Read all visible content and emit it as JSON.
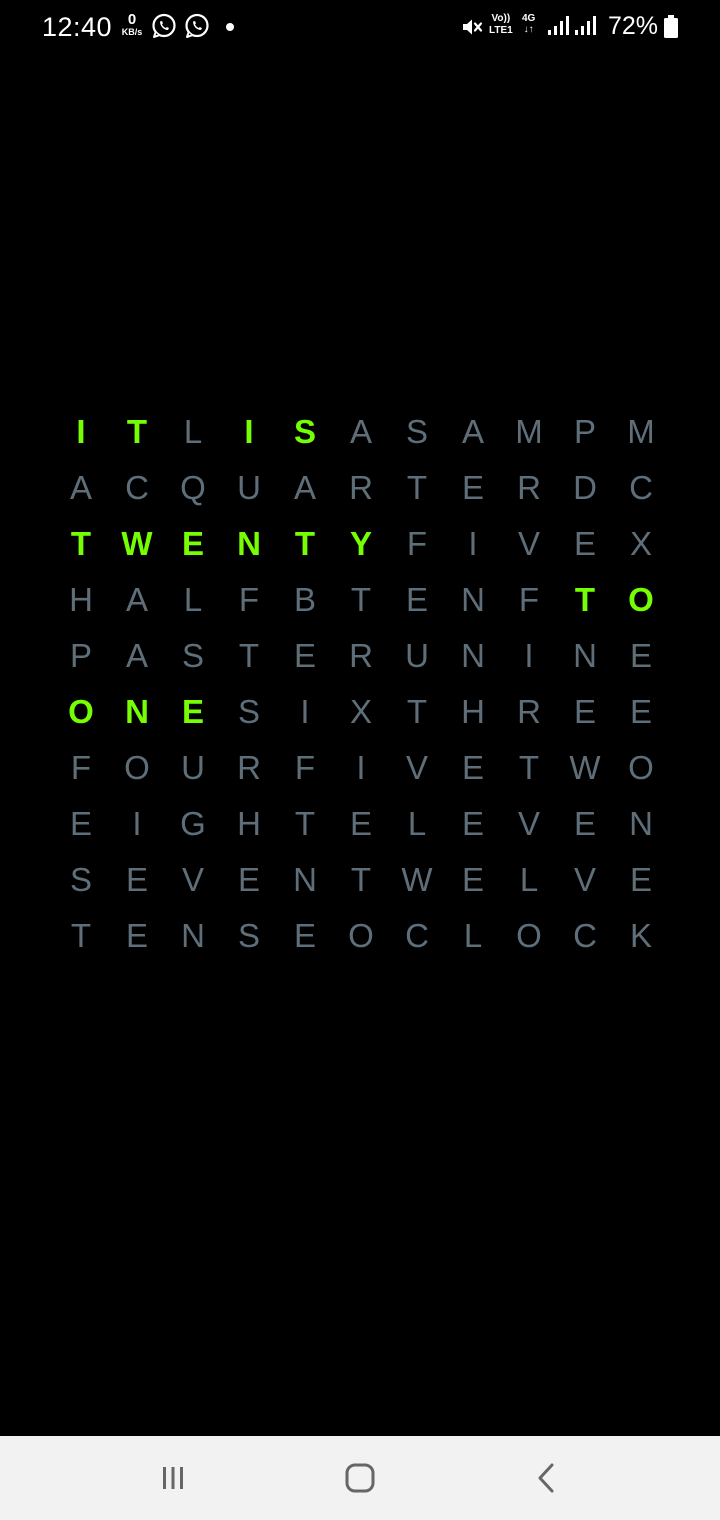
{
  "status_bar": {
    "time": "12:40",
    "net_speed_value": "0",
    "net_speed_unit": "KB/s",
    "volte_top": "Vo))",
    "volte_bottom": "LTE1",
    "network_type": "4G",
    "network_arrows": "↓↑",
    "battery_percent": "72%",
    "notification_icons": [
      "whatsapp-icon",
      "whatsapp-icon",
      "dot-icon"
    ],
    "system_icons": [
      "mute-icon",
      "volte-icon",
      "4g-icon",
      "signal-icon",
      "signal-icon",
      "battery-icon"
    ]
  },
  "word_clock": {
    "colors": {
      "on": "#76ff03",
      "off": "#5f6f7a",
      "background": "#000000"
    },
    "rows": [
      {
        "letters": [
          "I",
          "T",
          "L",
          "I",
          "S",
          "A",
          "S",
          "A",
          "M",
          "P",
          "M"
        ],
        "on": [
          1,
          1,
          0,
          1,
          1,
          0,
          0,
          0,
          0,
          0,
          0
        ]
      },
      {
        "letters": [
          "A",
          "C",
          "Q",
          "U",
          "A",
          "R",
          "T",
          "E",
          "R",
          "D",
          "C"
        ],
        "on": [
          0,
          0,
          0,
          0,
          0,
          0,
          0,
          0,
          0,
          0,
          0
        ]
      },
      {
        "letters": [
          "T",
          "W",
          "E",
          "N",
          "T",
          "Y",
          "F",
          "I",
          "V",
          "E",
          "X"
        ],
        "on": [
          1,
          1,
          1,
          1,
          1,
          1,
          0,
          0,
          0,
          0,
          0
        ]
      },
      {
        "letters": [
          "H",
          "A",
          "L",
          "F",
          "B",
          "T",
          "E",
          "N",
          "F",
          "T",
          "O"
        ],
        "on": [
          0,
          0,
          0,
          0,
          0,
          0,
          0,
          0,
          0,
          1,
          1
        ]
      },
      {
        "letters": [
          "P",
          "A",
          "S",
          "T",
          "E",
          "R",
          "U",
          "N",
          "I",
          "N",
          "E"
        ],
        "on": [
          0,
          0,
          0,
          0,
          0,
          0,
          0,
          0,
          0,
          0,
          0
        ]
      },
      {
        "letters": [
          "O",
          "N",
          "E",
          "S",
          "I",
          "X",
          "T",
          "H",
          "R",
          "E",
          "E"
        ],
        "on": [
          1,
          1,
          1,
          0,
          0,
          0,
          0,
          0,
          0,
          0,
          0
        ]
      },
      {
        "letters": [
          "F",
          "O",
          "U",
          "R",
          "F",
          "I",
          "V",
          "E",
          "T",
          "W",
          "O"
        ],
        "on": [
          0,
          0,
          0,
          0,
          0,
          0,
          0,
          0,
          0,
          0,
          0
        ]
      },
      {
        "letters": [
          "E",
          "I",
          "G",
          "H",
          "T",
          "E",
          "L",
          "E",
          "V",
          "E",
          "N"
        ],
        "on": [
          0,
          0,
          0,
          0,
          0,
          0,
          0,
          0,
          0,
          0,
          0
        ]
      },
      {
        "letters": [
          "S",
          "E",
          "V",
          "E",
          "N",
          "T",
          "W",
          "E",
          "L",
          "V",
          "E"
        ],
        "on": [
          0,
          0,
          0,
          0,
          0,
          0,
          0,
          0,
          0,
          0,
          0
        ]
      },
      {
        "letters": [
          "T",
          "E",
          "N",
          "S",
          "E",
          "O",
          "C",
          "L",
          "O",
          "C",
          "K"
        ],
        "on": [
          0,
          0,
          0,
          0,
          0,
          0,
          0,
          0,
          0,
          0,
          0
        ]
      }
    ]
  },
  "nav_bar": {
    "buttons": [
      "recents-icon",
      "home-icon",
      "back-icon"
    ]
  }
}
